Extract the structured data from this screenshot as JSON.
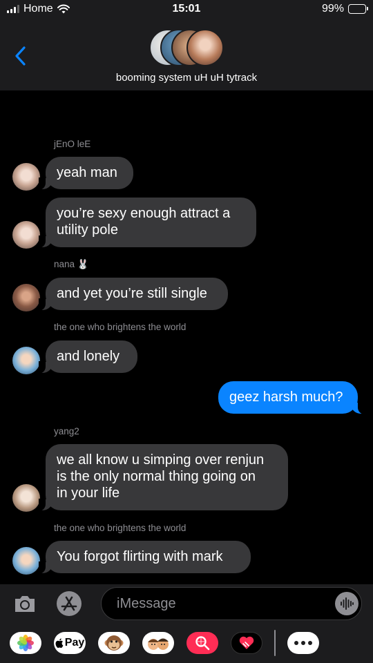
{
  "status_bar": {
    "carrier": "Home",
    "time": "15:01",
    "battery": "99%",
    "battery_level": 0.99
  },
  "header": {
    "back_icon": "chevron-left-icon",
    "group_name": "booming system uH uH tytrack"
  },
  "messages": [
    {
      "sender": "jEnO leE",
      "text": "yeah man",
      "type": "incoming"
    },
    {
      "sender": "",
      "text": "you’re sexy enough attract a\nutility pole",
      "type": "incoming"
    },
    {
      "sender": "nana 🐰",
      "text": "and yet you’re still single",
      "type": "incoming"
    },
    {
      "sender": "the one who brightens the world",
      "text": "and lonely",
      "type": "incoming"
    },
    {
      "sender": "",
      "text": "geez harsh much?",
      "type": "outgoing"
    },
    {
      "sender": "yang2",
      "text": "we all know u simping over renjun\nis the only normal thing going on\nin your life",
      "type": "incoming"
    },
    {
      "sender": "the one who brightens the world",
      "text": "You forgot flirting with mark",
      "type": "incoming"
    }
  ],
  "input": {
    "placeholder": "iMessage",
    "camera_icon": "camera-icon",
    "apps_icon": "app-store-icon",
    "audio_icon": "audio-waveform-icon"
  },
  "drawer": {
    "apple_pay_label": "Pay",
    "apps": [
      "photos-icon",
      "apple-pay-icon",
      "monkey-memoji-icon",
      "memoji-stickers-icon",
      "web-images-search-icon",
      "digital-touch-icon",
      "more-icon"
    ]
  },
  "colors": {
    "bubble_incoming": "#38383a",
    "bubble_outgoing": "#0a84ff",
    "bar": "#1c1c1e",
    "secondary_text": "#8e8e93"
  }
}
